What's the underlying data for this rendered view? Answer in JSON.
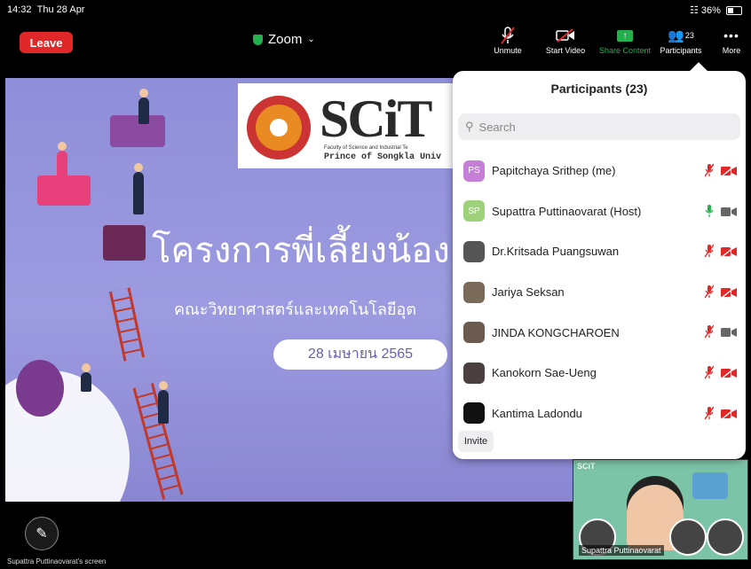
{
  "status": {
    "time": "14:32",
    "date": "Thu 28 Apr",
    "battery": "36%"
  },
  "toolbar": {
    "leave": "Leave",
    "title": "Zoom",
    "unmute": "Unmute",
    "start_video": "Start Video",
    "share": "Share Content",
    "participants": "Participants",
    "participant_count": "23",
    "more": "More",
    "share_color": "#23b14d",
    "leave_color": "#e02828"
  },
  "slide": {
    "logo_text": "SCiT",
    "logo_sub1": "Faculty of Science and Industrial Te",
    "logo_sub2": "Prince of Songkla Univ",
    "title": "โครงการพี่เลี้ยงน้อง",
    "subtitle": "คณะวิทยาศาสตร์และเทคโนโลยีอุต",
    "date": "28 เมษายน 2565"
  },
  "screen_label": "Supattra Puttinaovarat's screen",
  "video": {
    "mini_logo": "SCiT",
    "name": "Supattra Puttinaovarat"
  },
  "participants_panel": {
    "title": "Participants (23)",
    "search_placeholder": "Search",
    "invite": "Invite",
    "items": [
      {
        "name": "Papitchaya Srithep (me)",
        "initials": "PS",
        "avatar_color": "#c57fd6",
        "mic": "muted",
        "video": "off"
      },
      {
        "name": "Supattra Puttinaovarat (Host)",
        "initials": "SP",
        "avatar_color": "#9ed27a",
        "mic": "on",
        "video": "on"
      },
      {
        "name": "Dr.Kritsada Puangsuwan",
        "initials": "",
        "avatar_color": "#555555",
        "mic": "muted",
        "video": "off"
      },
      {
        "name": "Jariya Seksan",
        "initials": "",
        "avatar_color": "#7a6a5a",
        "mic": "muted",
        "video": "off"
      },
      {
        "name": "JINDA KONGCHAROEN",
        "initials": "",
        "avatar_color": "#6a5a50",
        "mic": "muted",
        "video": "on"
      },
      {
        "name": "Kanokorn Sae-Ueng",
        "initials": "",
        "avatar_color": "#4a4040",
        "mic": "muted",
        "video": "off"
      },
      {
        "name": "Kantima Ladondu",
        "initials": "",
        "avatar_color": "#111111",
        "mic": "muted",
        "video": "off"
      }
    ]
  }
}
